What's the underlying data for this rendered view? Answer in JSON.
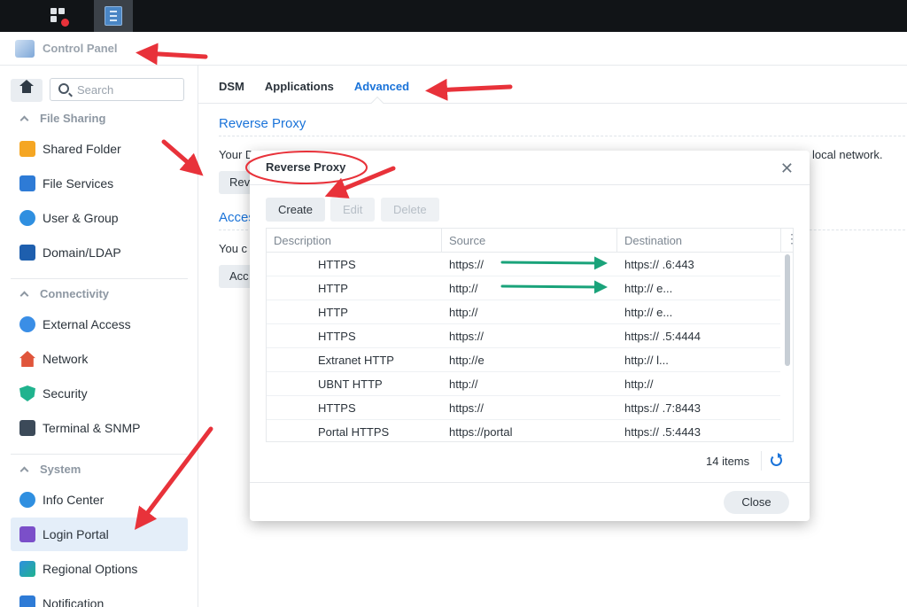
{
  "window": {
    "app_title": "Control Panel"
  },
  "sidebar": {
    "search_placeholder": "Search",
    "sections": [
      "File Sharing",
      "Connectivity",
      "System"
    ],
    "items": [
      {
        "label": "Shared Folder",
        "icon": "folder-icon"
      },
      {
        "label": "File Services",
        "icon": "file-services-icon"
      },
      {
        "label": "User & Group",
        "icon": "user-group-icon"
      },
      {
        "label": "Domain/LDAP",
        "icon": "domain-icon"
      },
      {
        "label": "External Access",
        "icon": "external-access-icon"
      },
      {
        "label": "Network",
        "icon": "network-icon"
      },
      {
        "label": "Security",
        "icon": "shield-icon"
      },
      {
        "label": "Terminal & SNMP",
        "icon": "terminal-icon"
      },
      {
        "label": "Info Center",
        "icon": "info-icon"
      },
      {
        "label": "Login Portal",
        "icon": "login-portal-icon"
      },
      {
        "label": "Regional Options",
        "icon": "globe-icon"
      },
      {
        "label": "Notification",
        "icon": "notification-icon"
      }
    ]
  },
  "main": {
    "tabs": [
      "DSM",
      "Applications",
      "Advanced"
    ],
    "active_tab": "Advanced",
    "sections": [
      {
        "title": "Reverse Proxy",
        "text_left": "Your D",
        "text_right": "local network.",
        "button": "Rev"
      },
      {
        "title": "Acces",
        "text_left": "You c",
        "button": "Acc"
      }
    ]
  },
  "dialog": {
    "title": "Reverse Proxy",
    "buttons": {
      "create": "Create",
      "edit": "Edit",
      "delete": "Delete"
    },
    "columns": [
      "Description",
      "Source",
      "Destination"
    ],
    "rows": [
      {
        "description": "HTTPS",
        "source": "https://",
        "destination": "https://          .6:443"
      },
      {
        "description": "HTTP",
        "source": "http://",
        "destination": "http://               e..."
      },
      {
        "description": "HTTP",
        "source": "http://",
        "destination": "http://               e..."
      },
      {
        "description": "HTTPS",
        "source": "https://",
        "destination": "https://          .5:4444"
      },
      {
        "description": "Extranet HTTP",
        "source": "http://e",
        "destination": "http://               l..."
      },
      {
        "description": "UBNT HTTP",
        "source": "http://",
        "destination": "http://"
      },
      {
        "description": "HTTPS",
        "source": "https://",
        "destination": "https://          .7:8443"
      },
      {
        "description": "Portal HTTPS",
        "source": "https://portal",
        "destination": "https://          .5:4443"
      }
    ],
    "item_count": "14 items",
    "close_label": "Close"
  },
  "colors": {
    "accent": "#1a73d9",
    "annotation_red": "#e8323a",
    "annotation_green": "#1aa37a"
  }
}
